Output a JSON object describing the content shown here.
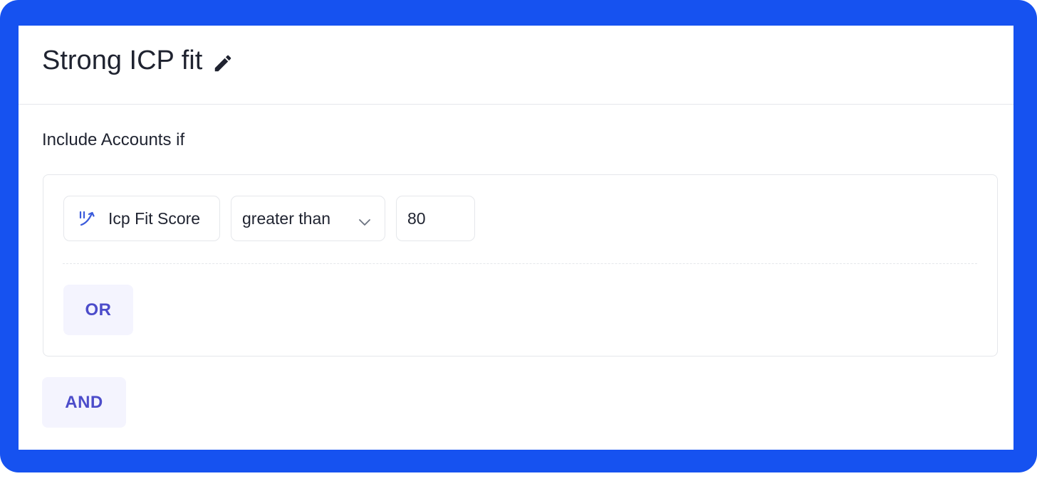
{
  "segment": {
    "title": "Strong ICP fit",
    "edit_icon": "pencil-icon"
  },
  "include_label": "Include Accounts if",
  "condition_group": {
    "rules": [
      {
        "field": "Icp Fit Score",
        "field_icon": "score-trend-icon",
        "operator": "greater than",
        "operator_icon": "chevron-down-icon",
        "value": "80"
      }
    ],
    "or_label": "OR"
  },
  "and_label": "AND",
  "colors": {
    "frame": "#1652f0",
    "accent_text": "#4c4cca",
    "button_bg": "#f4f4fe",
    "icon_blue": "#3b5bdb"
  }
}
